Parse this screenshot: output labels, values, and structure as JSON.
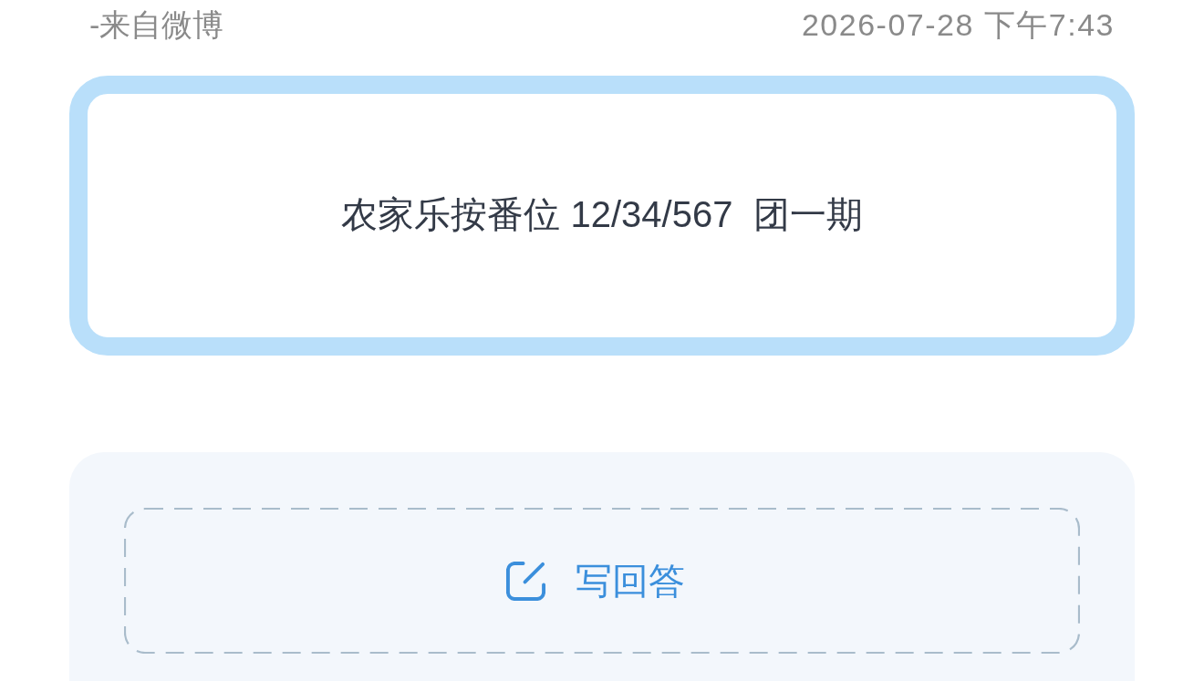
{
  "post": {
    "source": "-来自微博",
    "time": "2026-07-28 下午7:43"
  },
  "question_card": {
    "text": "农家乐按番位 12/34/567  团一期"
  },
  "answer_panel": {
    "button": {
      "label": "写回答"
    }
  }
}
